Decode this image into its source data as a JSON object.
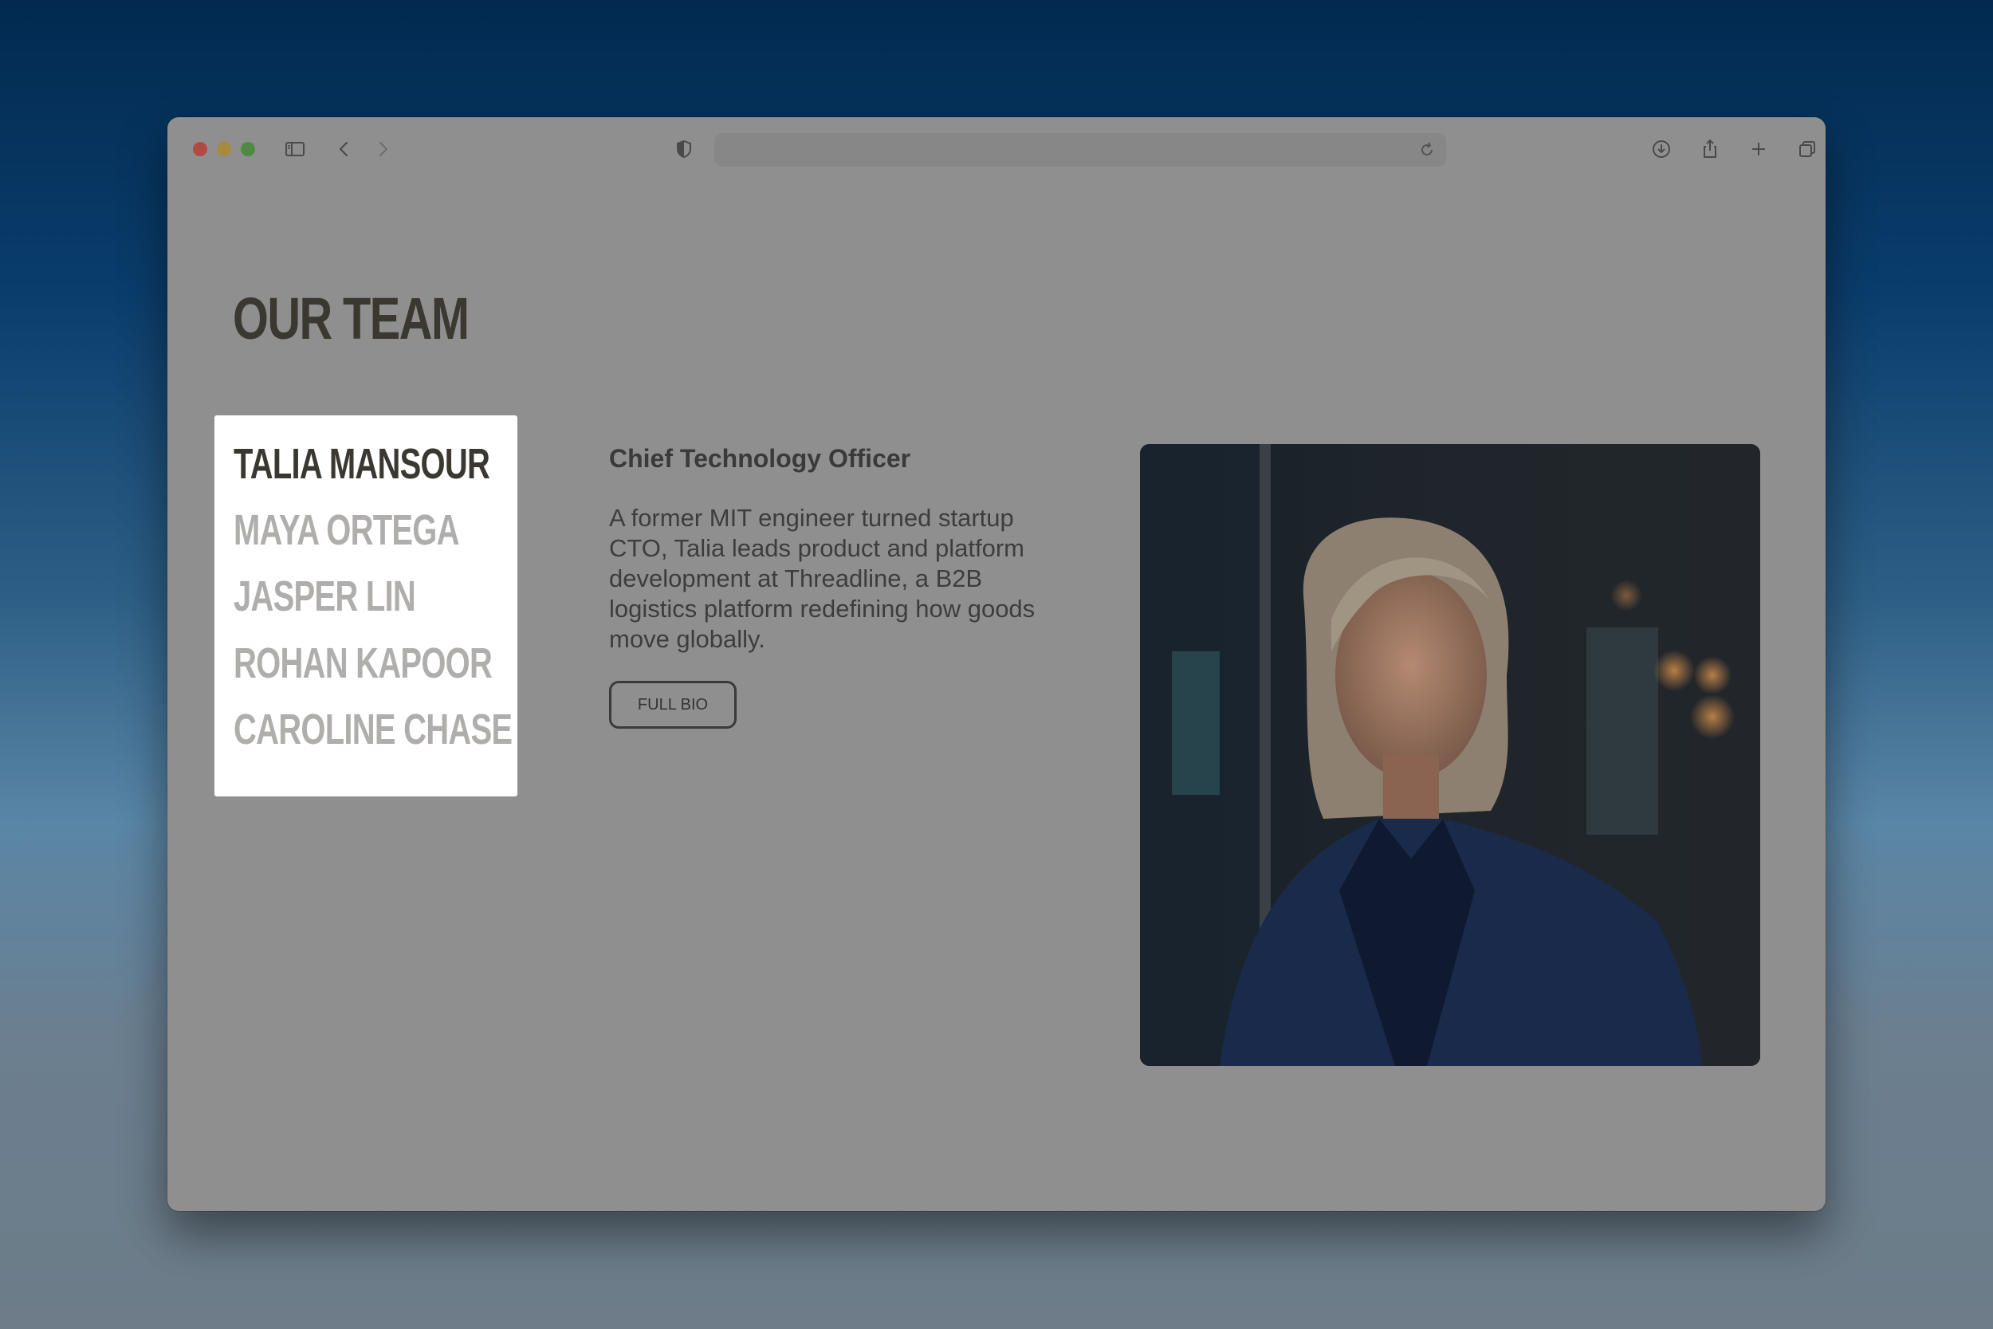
{
  "browser": {
    "url_text": ""
  },
  "page": {
    "title": "OUR TEAM",
    "team": [
      {
        "name": "TALIA MANSOUR",
        "active": true
      },
      {
        "name": "MAYA ORTEGA",
        "active": false
      },
      {
        "name": "JASPER LIN",
        "active": false
      },
      {
        "name": "ROHAN KAPOOR",
        "active": false
      },
      {
        "name": "CAROLINE CHASE",
        "active": false
      }
    ],
    "selected": {
      "role": "Chief Technology Officer",
      "bio": "A former MIT engineer turned startup CTO, Talia leads product and platform development at Threadline, a B2B logistics platform redefining how goods move globally.",
      "button_label": "FULL BIO"
    }
  },
  "icons": {
    "sidebar": "sidebar-icon",
    "back": "chevron-left-icon",
    "forward": "chevron-right-icon",
    "privacy": "shield-icon",
    "reload": "reload-icon",
    "download": "download-icon",
    "share": "share-icon",
    "new_tab": "plus-icon",
    "tabs": "tabs-overview-icon"
  },
  "colors": {
    "active_name": "#3b3832",
    "inactive_name": "#b0aeac",
    "page_background": "#8f8f8f"
  }
}
